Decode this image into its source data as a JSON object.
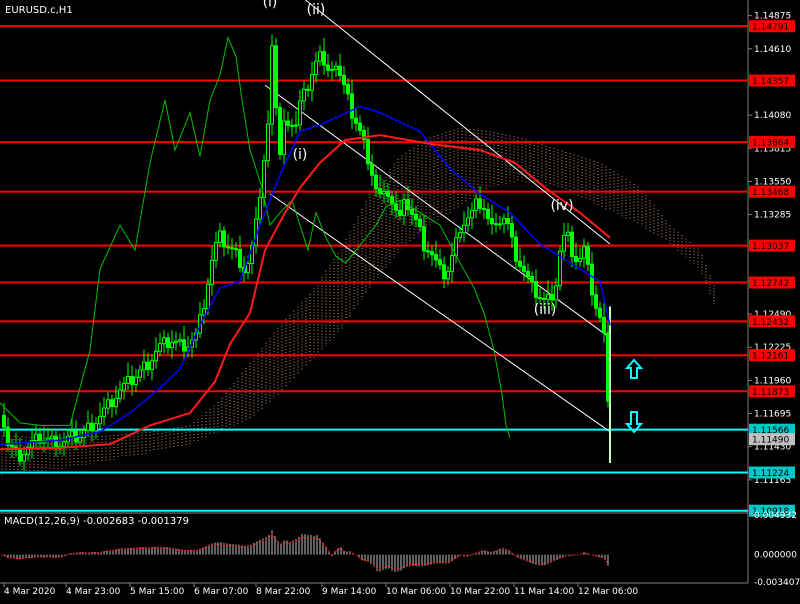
{
  "colors": {
    "background": "#000000",
    "text": "#ffffff",
    "resistance": "#ff0000",
    "support": "#00ffff",
    "bullish_candle": "#00ff00",
    "ma_red": "#ff1a1a",
    "ma_blue": "#0000ff",
    "chikou_green": "#00c000",
    "cloud": "#f0b090",
    "trend_channel": "#ffffff",
    "price_label_bg": "#ff0000",
    "current_label_bg": "#c0c0c0",
    "macd_hist": "#c0c0c0",
    "macd_signal": "#ff0000"
  },
  "chart_data": [
    {
      "type": "candlestick",
      "title": "EURUSD.c,H1",
      "ylim": [
        1.109,
        1.15
      ],
      "y_ticks": [
        "1.14875",
        "1.14610",
        "1.14080",
        "1.13815",
        "1.13550",
        "1.13285",
        "1.12755",
        "1.12490",
        "1.12225",
        "1.11960",
        "1.11695",
        "1.11430",
        "1.11165"
      ],
      "x_ticks": [
        "4 Mar 2020",
        "4 Mar 23:00",
        "5 Mar 15:00",
        "6 Mar 07:00",
        "8 Mar 22:00",
        "9 Mar 14:00",
        "10 Mar 06:00",
        "10 Mar 22:00",
        "11 Mar 14:00",
        "12 Mar 06:00"
      ],
      "resistance_levels": [
        "1.14791",
        "1.14357",
        "1.13864",
        "1.13468",
        "1.13037",
        "1.12742",
        "1.12432",
        "1.12161",
        "1.11873"
      ],
      "support_levels": [
        "1.11566",
        "1.11224",
        "1.10918"
      ],
      "current_price": "1.11490",
      "wave_labels": [
        "(i)",
        "(ii)",
        "(i)",
        "(iii)",
        "(iv)"
      ],
      "arrows": [
        "up",
        "down"
      ],
      "close_path": [
        [
          0,
          1.1168
        ],
        [
          4,
          1.1162
        ],
        [
          8,
          1.1145
        ],
        [
          12,
          1.1141
        ],
        [
          18,
          1.1135
        ],
        [
          25,
          1.114
        ],
        [
          32,
          1.1145
        ],
        [
          40,
          1.115
        ],
        [
          48,
          1.1148
        ],
        [
          55,
          1.1147
        ],
        [
          62,
          1.1146
        ],
        [
          70,
          1.115
        ],
        [
          80,
          1.1152
        ],
        [
          90,
          1.116
        ],
        [
          100,
          1.1168
        ],
        [
          110,
          1.1178
        ],
        [
          120,
          1.1188
        ],
        [
          130,
          1.1195
        ],
        [
          140,
          1.1203
        ],
        [
          150,
          1.1212
        ],
        [
          158,
          1.1222
        ],
        [
          166,
          1.1226
        ],
        [
          172,
          1.1228
        ],
        [
          180,
          1.1225
        ],
        [
          188,
          1.1226
        ],
        [
          196,
          1.1232
        ],
        [
          202,
          1.125
        ],
        [
          208,
          1.1275
        ],
        [
          214,
          1.13
        ],
        [
          220,
          1.131
        ],
        [
          226,
          1.1305
        ],
        [
          232,
          1.13
        ],
        [
          238,
          1.1295
        ],
        [
          244,
          1.1285
        ],
        [
          250,
          1.1292
        ],
        [
          256,
          1.132
        ],
        [
          262,
          1.136
        ],
        [
          268,
          1.14
        ],
        [
          272,
          1.146
        ],
        [
          276,
          1.142
        ],
        [
          280,
          1.138
        ],
        [
          285,
          1.141
        ],
        [
          290,
          1.139
        ],
        [
          296,
          1.1405
        ],
        [
          302,
          1.143
        ],
        [
          308,
          1.1425
        ],
        [
          314,
          1.144
        ],
        [
          318,
          1.147
        ],
        [
          322,
          1.145
        ],
        [
          328,
          1.144
        ],
        [
          334,
          1.1455
        ],
        [
          340,
          1.144
        ],
        [
          346,
          1.1425
        ],
        [
          352,
          1.141
        ],
        [
          358,
          1.14
        ],
        [
          364,
          1.1385
        ],
        [
          370,
          1.137
        ],
        [
          376,
          1.135
        ],
        [
          382,
          1.134
        ],
        [
          388,
          1.1348
        ],
        [
          394,
          1.1335
        ],
        [
          400,
          1.1325
        ],
        [
          406,
          1.134
        ],
        [
          412,
          1.133
        ],
        [
          418,
          1.132
        ],
        [
          424,
          1.1305
        ],
        [
          430,
          1.13
        ],
        [
          436,
          1.129
        ],
        [
          442,
          1.128
        ],
        [
          448,
          1.1285
        ],
        [
          454,
          1.13
        ],
        [
          460,
          1.132
        ],
        [
          466,
          1.1325
        ],
        [
          472,
          1.133
        ],
        [
          478,
          1.134
        ],
        [
          484,
          1.1335
        ],
        [
          490,
          1.132
        ],
        [
          496,
          1.1315
        ],
        [
          502,
          1.133
        ],
        [
          508,
          1.132
        ],
        [
          514,
          1.13
        ],
        [
          520,
          1.129
        ],
        [
          526,
          1.128
        ],
        [
          532,
          1.127
        ],
        [
          538,
          1.1265
        ],
        [
          544,
          1.126
        ],
        [
          550,
          1.1262
        ],
        [
          556,
          1.1275
        ],
        [
          560,
          1.13
        ],
        [
          566,
          1.1315
        ],
        [
          572,
          1.13
        ],
        [
          578,
          1.129
        ],
        [
          584,
          1.13
        ],
        [
          590,
          1.1275
        ],
        [
          596,
          1.1255
        ],
        [
          602,
          1.124
        ],
        [
          606,
          1.122
        ],
        [
          610,
          1.115
        ]
      ],
      "ma_red": [
        [
          0,
          1.1141
        ],
        [
          60,
          1.1142
        ],
        [
          110,
          1.1145
        ],
        [
          150,
          1.116
        ],
        [
          190,
          1.117
        ],
        [
          215,
          1.1195
        ],
        [
          230,
          1.1225
        ],
        [
          250,
          1.125
        ],
        [
          265,
          1.13
        ],
        [
          285,
          1.133
        ],
        [
          300,
          1.135
        ],
        [
          320,
          1.137
        ],
        [
          345,
          1.1388
        ],
        [
          380,
          1.1392
        ],
        [
          430,
          1.1385
        ],
        [
          480,
          1.138
        ],
        [
          515,
          1.137
        ],
        [
          545,
          1.135
        ],
        [
          580,
          1.133
        ],
        [
          610,
          1.131
        ]
      ],
      "ma_blue": [
        [
          0,
          1.1145
        ],
        [
          60,
          1.1148
        ],
        [
          100,
          1.1155
        ],
        [
          130,
          1.117
        ],
        [
          160,
          1.119
        ],
        [
          180,
          1.1205
        ],
        [
          200,
          1.124
        ],
        [
          220,
          1.127
        ],
        [
          240,
          1.1275
        ],
        [
          260,
          1.132
        ],
        [
          280,
          1.136
        ],
        [
          300,
          1.1395
        ],
        [
          320,
          1.14
        ],
        [
          360,
          1.1415
        ],
        [
          380,
          1.141
        ],
        [
          420,
          1.1395
        ],
        [
          450,
          1.1365
        ],
        [
          480,
          1.1345
        ],
        [
          510,
          1.133
        ],
        [
          540,
          1.1305
        ],
        [
          570,
          1.129
        ],
        [
          600,
          1.1275
        ],
        [
          610,
          1.124
        ]
      ],
      "chikou": [
        [
          0,
          1.1178
        ],
        [
          20,
          1.1162
        ],
        [
          40,
          1.116
        ],
        [
          70,
          1.116
        ],
        [
          90,
          1.122
        ],
        [
          100,
          1.1285
        ],
        [
          120,
          1.132
        ],
        [
          135,
          1.13
        ],
        [
          150,
          1.137
        ],
        [
          165,
          1.142
        ],
        [
          175,
          1.138
        ],
        [
          190,
          1.141
        ],
        [
          200,
          1.1375
        ],
        [
          210,
          1.142
        ],
        [
          220,
          1.144
        ],
        [
          228,
          1.147
        ],
        [
          236,
          1.1455
        ],
        [
          242,
          1.142
        ],
        [
          250,
          1.138
        ],
        [
          262,
          1.135
        ],
        [
          270,
          1.132
        ],
        [
          280,
          1.133
        ],
        [
          292,
          1.134
        ],
        [
          300,
          1.132
        ],
        [
          308,
          1.13
        ],
        [
          316,
          1.133
        ],
        [
          326,
          1.131
        ],
        [
          336,
          1.1295
        ],
        [
          346,
          1.129
        ],
        [
          356,
          1.13
        ],
        [
          366,
          1.131
        ],
        [
          376,
          1.132
        ],
        [
          386,
          1.1335
        ],
        [
          400,
          1.134
        ],
        [
          420,
          1.133
        ],
        [
          440,
          1.132
        ],
        [
          460,
          1.129
        ],
        [
          474,
          1.127
        ],
        [
          484,
          1.125
        ],
        [
          494,
          1.122
        ],
        [
          502,
          1.1185
        ],
        [
          506,
          1.116
        ],
        [
          510,
          1.115
        ]
      ],
      "cloud_upper": [
        [
          0,
          1.1152
        ],
        [
          60,
          1.115
        ],
        [
          110,
          1.1152
        ],
        [
          150,
          1.1155
        ],
        [
          190,
          1.116
        ],
        [
          220,
          1.118
        ],
        [
          250,
          1.121
        ],
        [
          280,
          1.124
        ],
        [
          310,
          1.1265
        ],
        [
          340,
          1.13
        ],
        [
          370,
          1.1345
        ],
        [
          400,
          1.1375
        ],
        [
          430,
          1.139
        ],
        [
          460,
          1.1398
        ],
        [
          490,
          1.1395
        ],
        [
          520,
          1.139
        ],
        [
          560,
          1.138
        ],
        [
          600,
          1.137
        ],
        [
          640,
          1.135
        ],
        [
          670,
          1.132
        ],
        [
          700,
          1.13
        ],
        [
          715,
          1.127
        ]
      ],
      "cloud_lower": [
        [
          0,
          1.112
        ],
        [
          60,
          1.1125
        ],
        [
          110,
          1.1132
        ],
        [
          150,
          1.1138
        ],
        [
          190,
          1.1145
        ],
        [
          220,
          1.1155
        ],
        [
          250,
          1.1165
        ],
        [
          280,
          1.1185
        ],
        [
          310,
          1.121
        ],
        [
          340,
          1.1235
        ],
        [
          370,
          1.127
        ],
        [
          400,
          1.13
        ],
        [
          430,
          1.132
        ],
        [
          460,
          1.1335
        ],
        [
          490,
          1.135
        ],
        [
          520,
          1.1355
        ],
        [
          560,
          1.135
        ],
        [
          600,
          1.1335
        ],
        [
          640,
          1.132
        ],
        [
          670,
          1.1305
        ],
        [
          700,
          1.1285
        ],
        [
          715,
          1.1255
        ]
      ],
      "channel_upper": [
        [
          290,
          1.151
        ],
        [
          610,
          1.1305
        ]
      ],
      "channel_lower": [
        [
          270,
          1.1345
        ],
        [
          610,
          1.1155
        ]
      ],
      "channel_mid": [
        [
          265,
          1.1432
        ],
        [
          610,
          1.123
        ]
      ]
    },
    {
      "type": "bar",
      "title": "MACD(12,26,9) -0.002683 -0.001379",
      "ylim": [
        -0.003407,
        0.004932
      ],
      "y_ticks": [
        "0.004932",
        "0.000000",
        "-0.003407"
      ]
    }
  ]
}
